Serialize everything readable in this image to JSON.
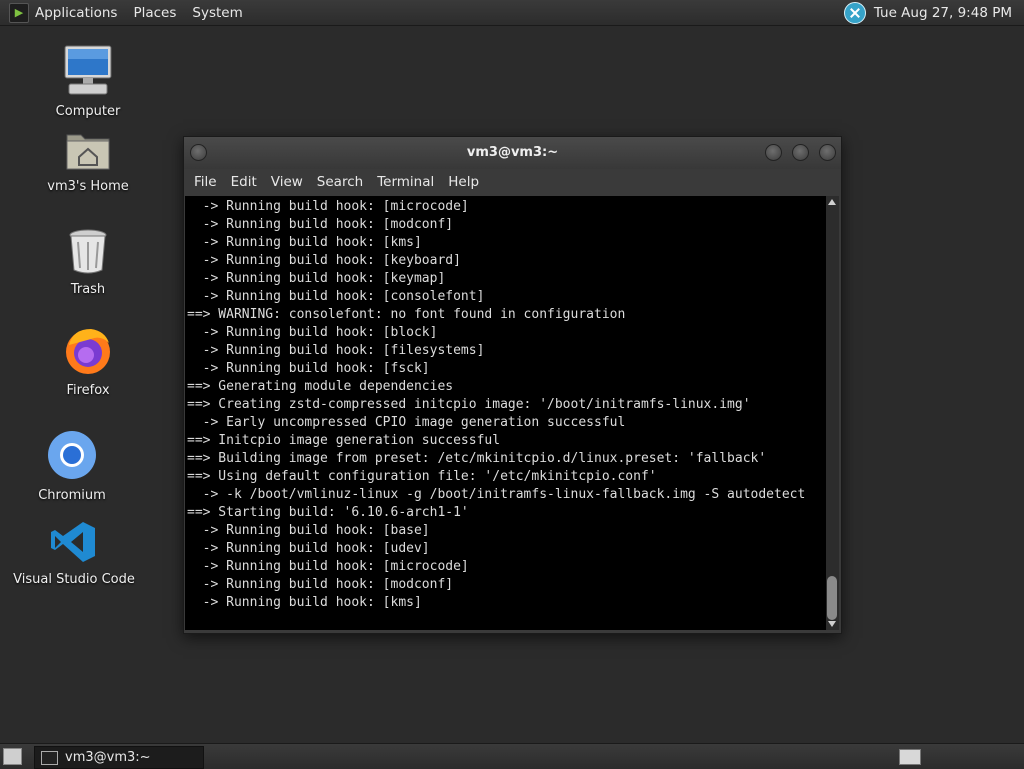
{
  "top_panel": {
    "menus": [
      "Applications",
      "Places",
      "System"
    ],
    "clock": "Tue Aug 27,  9:48 PM"
  },
  "desktop_icons": [
    {
      "label": "Computer",
      "icon": "computer-icon"
    },
    {
      "label": "vm3's Home",
      "icon": "home-folder-icon"
    },
    {
      "label": "Trash",
      "icon": "trash-icon"
    },
    {
      "label": "Firefox",
      "icon": "firefox-icon"
    },
    {
      "label": "Chromium",
      "icon": "chromium-icon"
    },
    {
      "label": "Visual Studio Code",
      "icon": "vscode-icon"
    }
  ],
  "terminal": {
    "title": "vm3@vm3:~",
    "menu": [
      "File",
      "Edit",
      "View",
      "Search",
      "Terminal",
      "Help"
    ],
    "lines": [
      "  -> Running build hook: [microcode]",
      "  -> Running build hook: [modconf]",
      "  -> Running build hook: [kms]",
      "  -> Running build hook: [keyboard]",
      "  -> Running build hook: [keymap]",
      "  -> Running build hook: [consolefont]",
      "==> WARNING: consolefont: no font found in configuration",
      "  -> Running build hook: [block]",
      "  -> Running build hook: [filesystems]",
      "  -> Running build hook: [fsck]",
      "==> Generating module dependencies",
      "==> Creating zstd-compressed initcpio image: '/boot/initramfs-linux.img'",
      "  -> Early uncompressed CPIO image generation successful",
      "==> Initcpio image generation successful",
      "==> Building image from preset: /etc/mkinitcpio.d/linux.preset: 'fallback'",
      "==> Using default configuration file: '/etc/mkinitcpio.conf'",
      "  -> -k /boot/vmlinuz-linux -g /boot/initramfs-linux-fallback.img -S autodetect",
      "==> Starting build: '6.10.6-arch1-1'",
      "  -> Running build hook: [base]",
      "  -> Running build hook: [udev]",
      "  -> Running build hook: [microcode]",
      "  -> Running build hook: [modconf]",
      "  -> Running build hook: [kms]"
    ]
  },
  "taskbar": {
    "task_label": "vm3@vm3:~"
  },
  "colors": {
    "desktop_bg": "#2b2b2b",
    "terminal_bg": "#000000",
    "terminal_fg": "#dcdcdc",
    "panel_bg": "#333333"
  }
}
